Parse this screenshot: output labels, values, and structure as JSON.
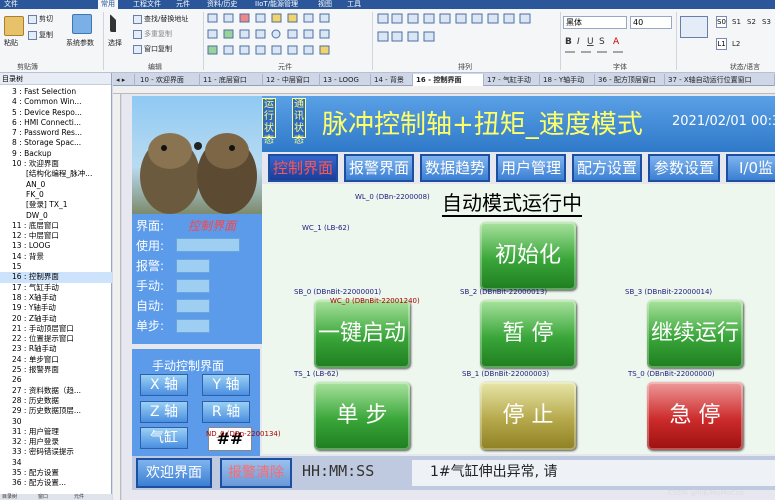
{
  "menu": [
    "文件",
    "常用",
    "工程文件",
    "元件",
    "资料/历史",
    "IIoT/能源管理",
    "视图",
    "工具"
  ],
  "ribbon": {
    "paste": "粘贴",
    "cut": "剪切",
    "copy": "复制",
    "system_params": "系统参数",
    "clipboard": "剪贴簿",
    "select": "选择",
    "find_replace": "查找/替换地址",
    "multi_copy": "多重复制",
    "window_copy": "窗口复制",
    "edit": "编辑",
    "elements": "元件",
    "arrange": "排列",
    "font_name": "黑体",
    "font_size": "40",
    "font": "字体",
    "states": [
      "S0",
      "S1",
      "S2",
      "S3",
      "L1",
      "L2"
    ],
    "state_label": "状态/语言"
  },
  "tree": {
    "title": "目录树",
    "items": [
      "3 : Fast Selection",
      "4 : Common Win...",
      "5 : Device Respo...",
      "6 : HMI Connecti...",
      "7 : Password Res...",
      "8 : Storage Spac...",
      "9 : Backup",
      "10 : 欢迎界面",
      "[结构化编程_脉冲...",
      "AN_0",
      "FK_0",
      "[登录] TX_1",
      "DW_0",
      "11 : 底层窗口",
      "12 : 中层窗口",
      "13 : LOOG",
      "14 : 背景",
      "15",
      "16 : 控制界面",
      "17 : 气缸手动",
      "18 : X轴手动",
      "19 : Y轴手动",
      "20 : Z轴手动",
      "21 : 手动顶层窗口",
      "22 : 位置提示窗口",
      "23 : R轴手动",
      "24 : 单步窗口",
      "25 : 报警界面",
      "26",
      "27 : 资料数据（趋...",
      "28 : 历史数据",
      "29 : 历史数据顶层...",
      "30",
      "31 : 用户管理",
      "32 : 用户登录",
      "33 : 密码错误提示",
      "34",
      "35 : 配方设置",
      "36 : 配方设置..."
    ],
    "bottom_tabs": [
      "目录树",
      "窗口",
      "元件"
    ]
  },
  "tabs": [
    "10 - 欢迎界面",
    "11 - 底层窗口",
    "12 - 中层窗口",
    "13 - LOOG",
    "14 - 背景",
    "16 - 控制界面",
    "17 - 气缸手动",
    "18 - Y轴手动",
    "36 - 配方顶层窗口",
    "37 - X轴自动运行位置窗口"
  ],
  "screen": {
    "status_vert": [
      "运行",
      "状态"
    ],
    "comm_vert": [
      "通讯",
      "状态"
    ],
    "title": "脉冲控制轴+扭矩_速度模式",
    "datetime": "2021/02/01 00:34",
    "nav": [
      "控制界面",
      "报警界面",
      "数据趋势",
      "用户管理",
      "配方设置",
      "参数设置",
      "I/0监"
    ],
    "mode_text": "自动模式运行中",
    "left_labels": [
      "界面:",
      "使用:",
      "报警:",
      "手动:",
      "自动:",
      "单步:"
    ],
    "interface_name": "控制界面",
    "manual_title": "手动控制界面",
    "manual_buttons": [
      "X 轴",
      "Y 轴",
      "Z 轴",
      "R 轴",
      "气缸"
    ],
    "hashes": "##",
    "buttons": {
      "init": "初始化",
      "start": "一键启动",
      "pause": "暂 停",
      "continue": "继续运行",
      "step": "单 步",
      "stop": "停 止",
      "estop": "急 停"
    },
    "addr": [
      "WL_0 (DBn-2200008)",
      "WC_1 (LB-62)",
      "SB_0 (DBnBit-22000001)",
      "WC_0 (DBnBit-22001240)",
      "SB_2 (DBnBit-22000013)",
      "SB_3 (DBnBit-22000014)",
      "TS_1 (LB-62)",
      "SB_1 (DBnBit-22000003)",
      "TS_0 (DBnBit-22000000)",
      "ND_0 (DBn-2200134)"
    ],
    "welcome": "欢迎界面",
    "alarm_clear": "报警清除",
    "time": "HH:MM:SS",
    "alarm_msg": "1#气缸伸出异常, 请"
  },
  "watermark": "CSDN @IIIE/MoMoCos"
}
